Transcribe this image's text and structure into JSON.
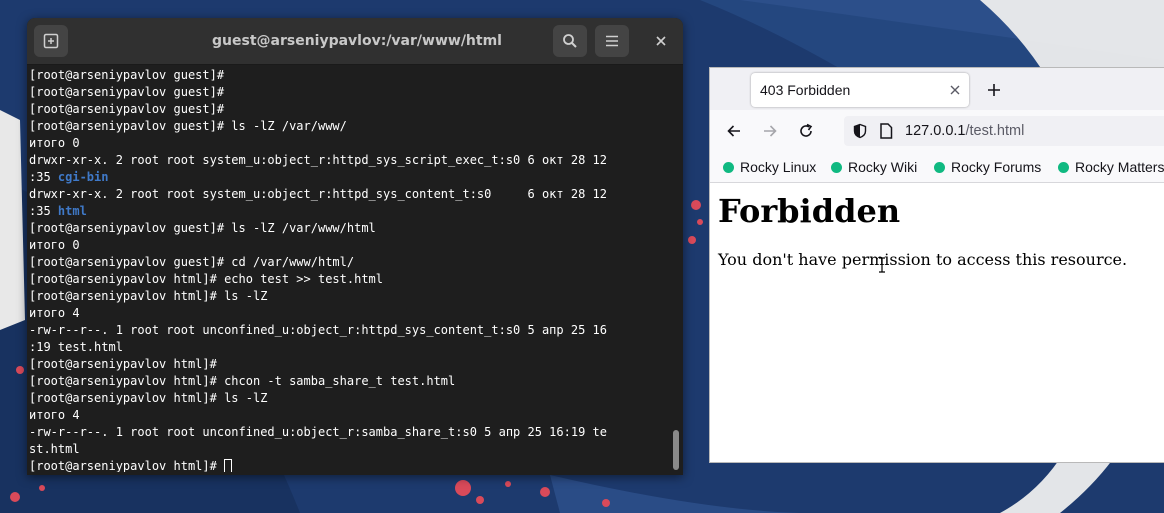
{
  "terminal": {
    "title": "guest@arseniypavlov:/var/www/html",
    "lines": [
      [
        {
          "t": "[root@arseniypavlov guest]#"
        }
      ],
      [
        {
          "t": "[root@arseniypavlov guest]#"
        }
      ],
      [
        {
          "t": "[root@arseniypavlov guest]#"
        }
      ],
      [
        {
          "t": "[root@arseniypavlov guest]# ls -lZ /var/www/"
        }
      ],
      [
        {
          "t": "итого 0"
        }
      ],
      [
        {
          "t": "drwxr-xr-x. 2 root root system_u:object_r:httpd_sys_script_exec_t:s0 6 окт 28 12"
        }
      ],
      [
        {
          "t": ":35 "
        },
        {
          "t": "cgi-bin",
          "c": "dir"
        }
      ],
      [
        {
          "t": "drwxr-xr-x. 2 root root system_u:object_r:httpd_sys_content_t:s0     6 окт 28 12"
        }
      ],
      [
        {
          "t": ":35 "
        },
        {
          "t": "html",
          "c": "dir"
        }
      ],
      [
        {
          "t": "[root@arseniypavlov guest]# ls -lZ /var/www/html"
        }
      ],
      [
        {
          "t": "итого 0"
        }
      ],
      [
        {
          "t": "[root@arseniypavlov guest]# cd /var/www/html/"
        }
      ],
      [
        {
          "t": "[root@arseniypavlov html]# echo test >> test.html"
        }
      ],
      [
        {
          "t": "[root@arseniypavlov html]# ls -lZ"
        }
      ],
      [
        {
          "t": "итого 4"
        }
      ],
      [
        {
          "t": "-rw-r--r--. 1 root root unconfined_u:object_r:httpd_sys_content_t:s0 5 апр 25 16"
        }
      ],
      [
        {
          "t": ":19 test.html"
        }
      ],
      [
        {
          "t": "[root@arseniypavlov html]#"
        }
      ],
      [
        {
          "t": "[root@arseniypavlov html]# chcon -t samba_share_t test.html"
        }
      ],
      [
        {
          "t": "[root@arseniypavlov html]# ls -lZ"
        }
      ],
      [
        {
          "t": "итого 4"
        }
      ],
      [
        {
          "t": "-rw-r--r--. 1 root root unconfined_u:object_r:samba_share_t:s0 5 апр 25 16:19 te"
        }
      ],
      [
        {
          "t": "st.html"
        }
      ],
      [
        {
          "t": "[root@arseniypavlov html]# "
        },
        {
          "cursor": true
        }
      ]
    ]
  },
  "browser": {
    "tab_title": "403 Forbidden",
    "url_host": "127.0.0.1",
    "url_path": "/test.html",
    "bookmarks": [
      {
        "label": "Rocky Linux"
      },
      {
        "label": "Rocky Wiki"
      },
      {
        "label": "Rocky Forums"
      },
      {
        "label": "Rocky Matters"
      }
    ],
    "heading": "Forbidden",
    "message": "You don't have permission to access this resource."
  },
  "icons": {
    "new_tab_terminal": "new-tab-icon",
    "search": "search-icon",
    "menu": "hamburger-menu-icon",
    "close": "close-icon",
    "back": "back-arrow-icon",
    "forward": "forward-arrow-icon",
    "reload": "reload-icon",
    "shield": "shield-icon",
    "page": "page-icon",
    "plus": "plus-icon"
  },
  "colors": {
    "terminal_bg": "#1e1e1e",
    "directory_blue": "#3f79c8",
    "rocky_green": "#10b981",
    "desktop_blue": "#1d3a6e"
  }
}
